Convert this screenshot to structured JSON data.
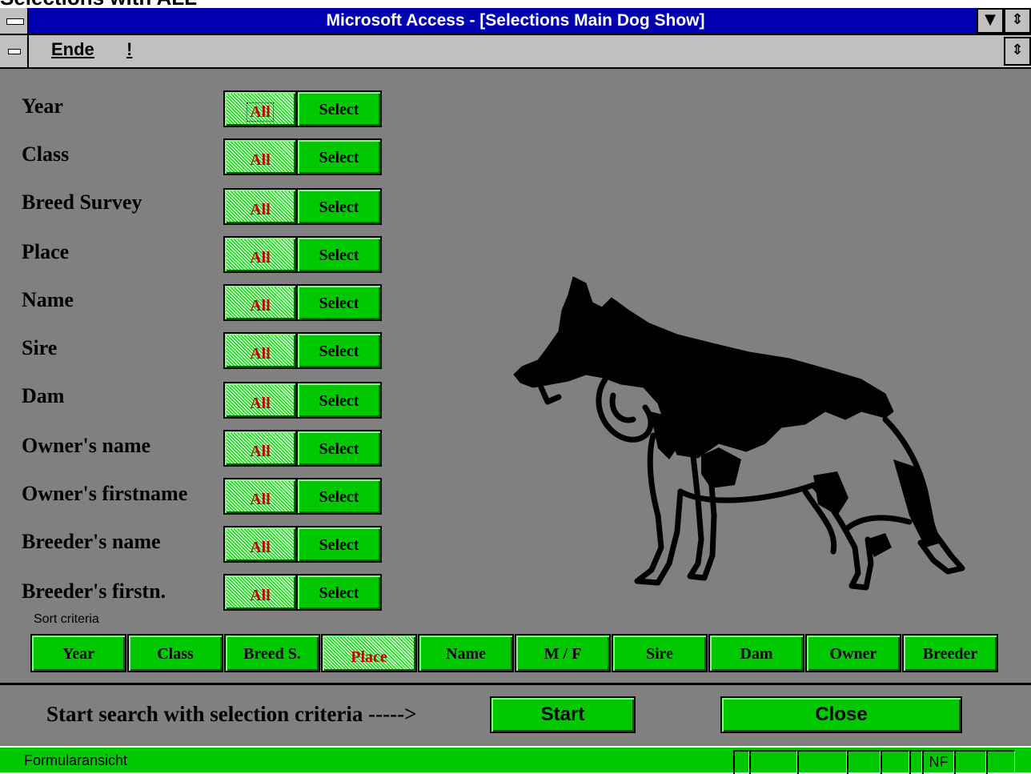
{
  "top_caption": "Selections with ALL",
  "window": {
    "title": "Microsoft Access - [Selections Main Dog Show]",
    "minimize_glyph": "▼",
    "restore_glyph": "⇕"
  },
  "menu": {
    "items": [
      {
        "label": "Ende"
      },
      {
        "label": "!"
      }
    ],
    "restore_glyph": "⇕"
  },
  "fields": [
    {
      "label": "Year",
      "all": "All",
      "select": "Select"
    },
    {
      "label": "Class",
      "all": "All",
      "select": "Select"
    },
    {
      "label": "Breed Survey",
      "all": "All",
      "select": "Select"
    },
    {
      "label": "Place",
      "all": "All",
      "select": "Select"
    },
    {
      "label": "Name",
      "all": "All",
      "select": "Select"
    },
    {
      "label": "Sire",
      "all": "All",
      "select": "Select"
    },
    {
      "label": "Dam",
      "all": "All",
      "select": "Select"
    },
    {
      "label": "Owner's name",
      "all": "All",
      "select": "Select"
    },
    {
      "label": "Owner's firstname",
      "all": "All",
      "select": "Select"
    },
    {
      "label": "Breeder's name",
      "all": "All",
      "select": "Select"
    },
    {
      "label": "Breeder's firstn.",
      "all": "All",
      "select": "Select"
    }
  ],
  "sort": {
    "label": "Sort criteria",
    "selected": "Place",
    "buttons": [
      "Year",
      "Class",
      "Breed S.",
      "Place",
      "Name",
      "M / F",
      "Sire",
      "Dam",
      "Owner",
      "Breeder"
    ]
  },
  "footer": {
    "prompt": "Start search with selection criteria ----->",
    "start_label": "Start",
    "close_label": "Close"
  },
  "status": {
    "text": "Formularansicht",
    "indicator": "NF"
  },
  "colors": {
    "form_bg": "#808080",
    "button_green": "#00c800",
    "title_blue": "#0000b0",
    "all_text": "#c00000"
  },
  "image": {
    "icon": "german-shepherd-dog-silhouette"
  }
}
